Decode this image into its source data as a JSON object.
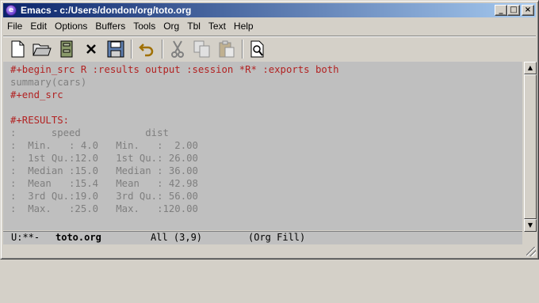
{
  "window": {
    "title": "Emacs - c:/Users/dondon/org/toto.org",
    "controls": {
      "minimize": "_",
      "maximize": "□",
      "close": "×"
    }
  },
  "menu": [
    "File",
    "Edit",
    "Options",
    "Buffers",
    "Tools",
    "Org",
    "Tbl",
    "Text",
    "Help"
  ],
  "toolbar": {
    "buttons": [
      {
        "name": "new-file-icon"
      },
      {
        "name": "open-folder-icon"
      },
      {
        "name": "dired-cabinet-icon"
      },
      {
        "name": "close-buffer-icon"
      },
      {
        "name": "save-floppy-icon"
      },
      {
        "name": "undo-icon"
      },
      {
        "name": "cut-scissors-icon"
      },
      {
        "name": "copy-icon"
      },
      {
        "name": "paste-icon"
      },
      {
        "name": "search-document-icon"
      }
    ]
  },
  "editor": {
    "lines": [
      {
        "text": "#+begin_src R :results output :session *R* :exports both",
        "color": "#b22222"
      },
      {
        "text": "summary(cars)",
        "color": "#7f7f7f"
      },
      {
        "text": "#+end_src",
        "color": "#b22222"
      },
      {
        "text": "",
        "color": "#7f7f7f"
      },
      {
        "text": "#+RESULTS:",
        "color": "#b22222"
      },
      {
        "text": ":      speed           dist",
        "color": "#7f7f7f"
      },
      {
        "text": ":  Min.   : 4.0   Min.   :  2.00",
        "color": "#7f7f7f"
      },
      {
        "text": ":  1st Qu.:12.0   1st Qu.: 26.00",
        "color": "#7f7f7f"
      },
      {
        "text": ":  Median :15.0   Median : 36.00",
        "color": "#7f7f7f"
      },
      {
        "text": ":  Mean   :15.4   Mean   : 42.98",
        "color": "#7f7f7f"
      },
      {
        "text": ":  3rd Qu.:19.0   3rd Qu.: 56.00",
        "color": "#7f7f7f"
      },
      {
        "text": ":  Max.   :25.0   Max.   :120.00",
        "color": "#7f7f7f"
      }
    ]
  },
  "modeline": {
    "status": "U:**-",
    "buffer": "toto.org",
    "position": "All (3,9)",
    "modes": "(Org Fill)"
  },
  "colors": {
    "org_keyword": "#b22222",
    "code_text": "#7f7f7f",
    "editor_bg": "#bfbfbf",
    "title_gradient_start": "#0a246a"
  }
}
